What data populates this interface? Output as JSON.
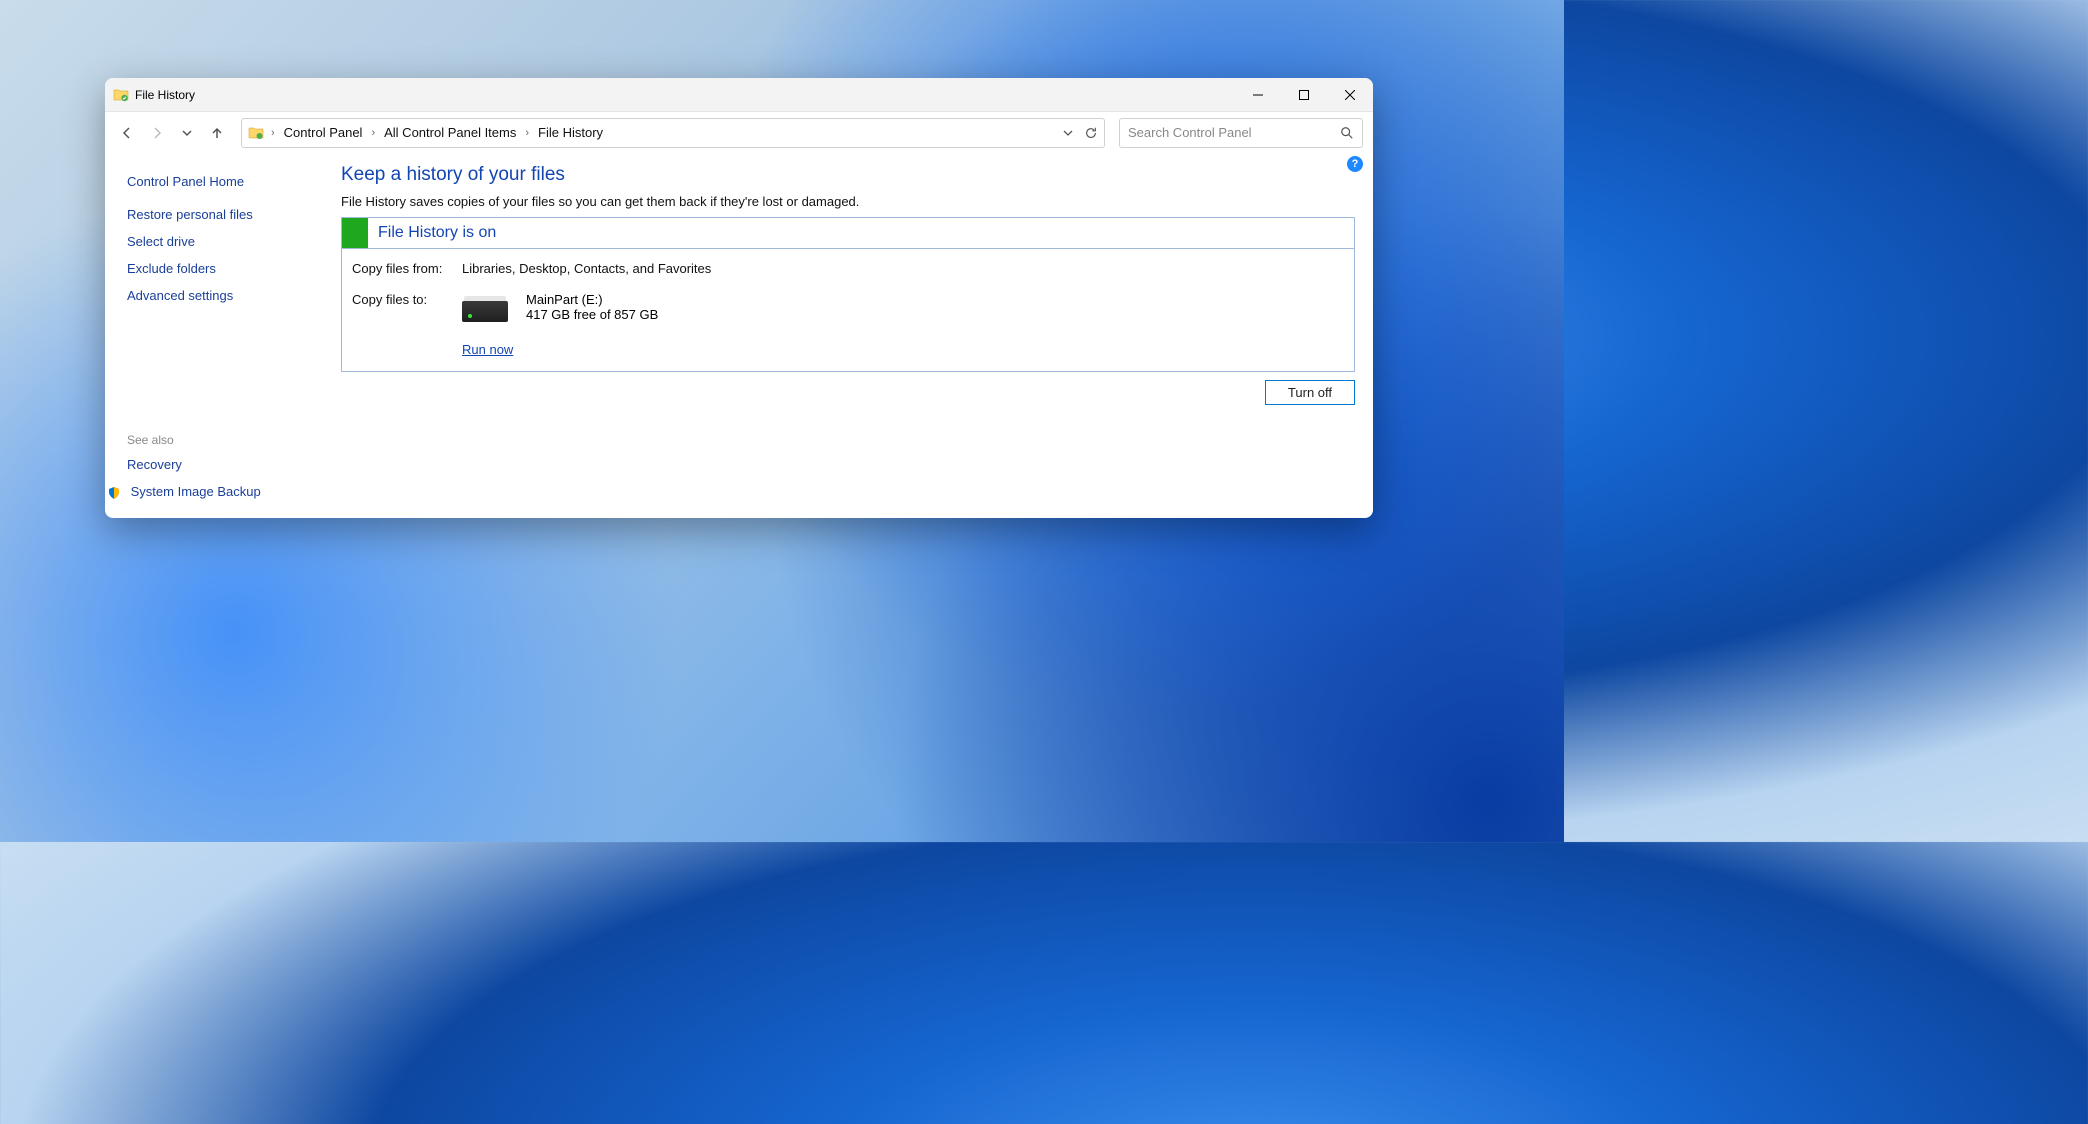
{
  "window": {
    "title": "File History"
  },
  "breadcrumb": {
    "items": [
      "Control Panel",
      "All Control Panel Items",
      "File History"
    ]
  },
  "search": {
    "placeholder": "Search Control Panel"
  },
  "sidebar": {
    "home": "Control Panel Home",
    "links": [
      "Restore personal files",
      "Select drive",
      "Exclude folders",
      "Advanced settings"
    ],
    "see_also_label": "See also",
    "see_also": [
      "Recovery",
      "System Image Backup"
    ]
  },
  "main": {
    "heading": "Keep a history of your files",
    "description": "File History saves copies of your files so you can get them back if they're lost or damaged.",
    "status_title": "File History is on",
    "copy_from_label": "Copy files from:",
    "copy_from_value": "Libraries, Desktop, Contacts, and Favorites",
    "copy_to_label": "Copy files to:",
    "drive_name": "MainPart (E:)",
    "drive_space": "417 GB free of 857 GB",
    "run_now": "Run now",
    "turn_off": "Turn off"
  },
  "help": {
    "tooltip": "?"
  }
}
